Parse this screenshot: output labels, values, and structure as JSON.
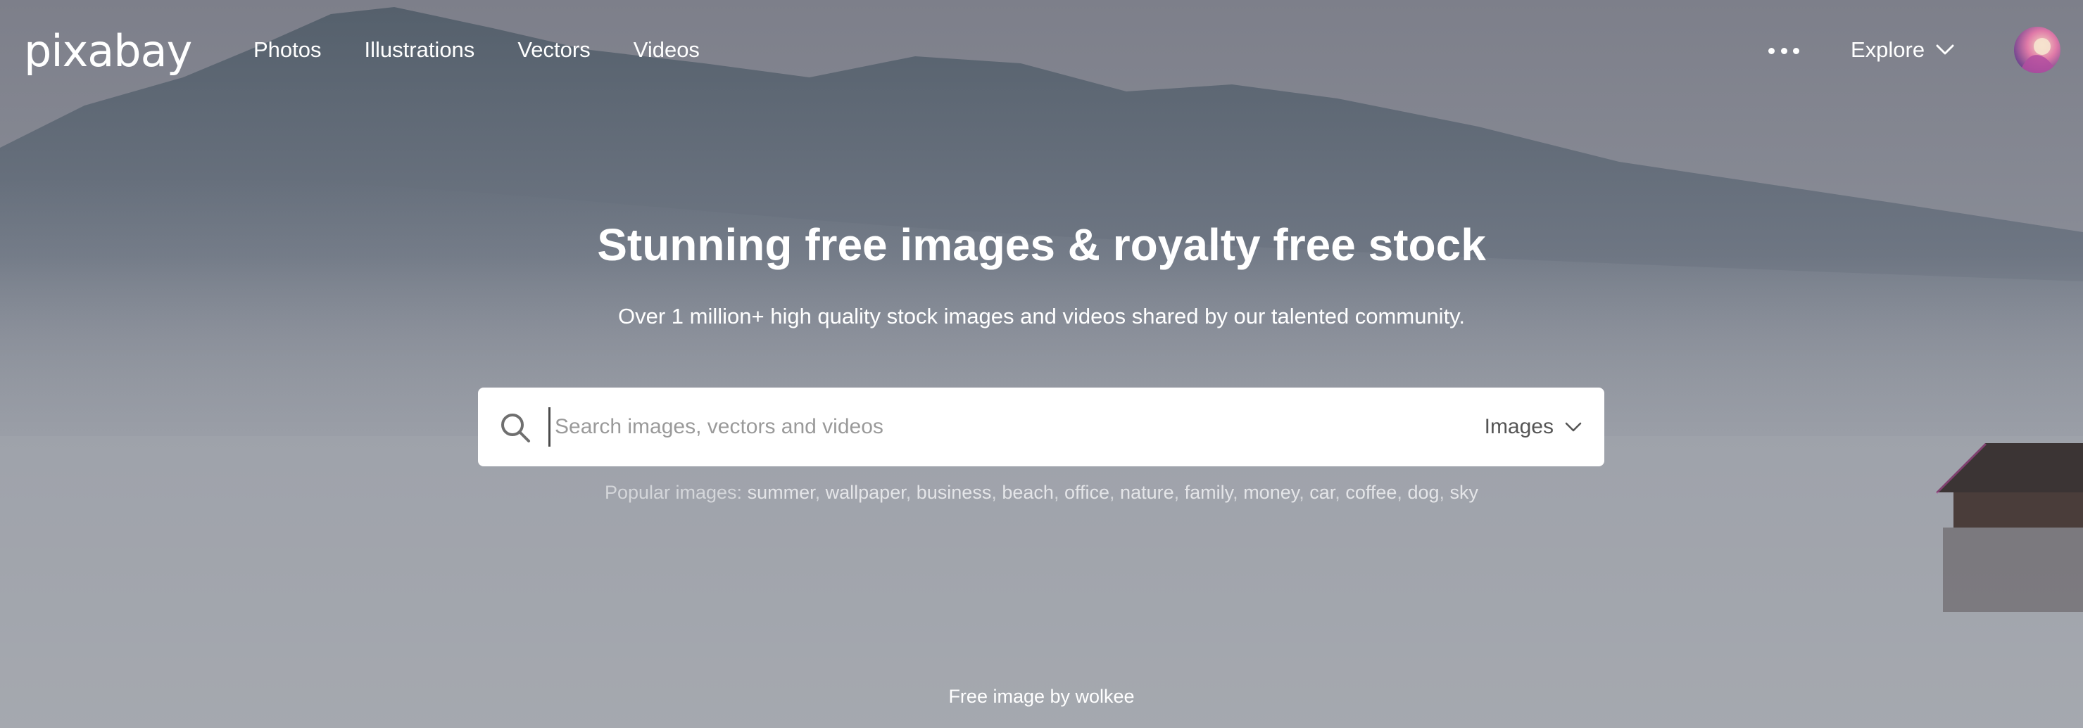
{
  "brand": {
    "logo_text": "pixabay"
  },
  "nav": {
    "items": [
      {
        "label": "Photos"
      },
      {
        "label": "Illustrations"
      },
      {
        "label": "Vectors"
      },
      {
        "label": "Videos"
      }
    ],
    "explore_label": "Explore",
    "more_icon": "more-horizontal-icon",
    "explore_icon": "chevron-down-icon"
  },
  "hero": {
    "title": "Stunning free images & royalty free stock",
    "subtitle": "Over 1 million+ high quality stock images and videos shared by our talented community."
  },
  "search": {
    "placeholder": "Search images, vectors and videos",
    "value": "",
    "type_selected": "Images",
    "icon": "search-icon"
  },
  "popular": {
    "prefix": "Popular images:",
    "tags": [
      "summer",
      "wallpaper",
      "business",
      "beach",
      "office",
      "nature",
      "family",
      "money",
      "car",
      "coffee",
      "dog",
      "sky"
    ]
  },
  "credit": {
    "text": "Free image by wolkee"
  },
  "colors": {
    "text_on_image": "#ffffff",
    "search_bg": "#ffffff",
    "placeholder": "#9a9a9a"
  }
}
